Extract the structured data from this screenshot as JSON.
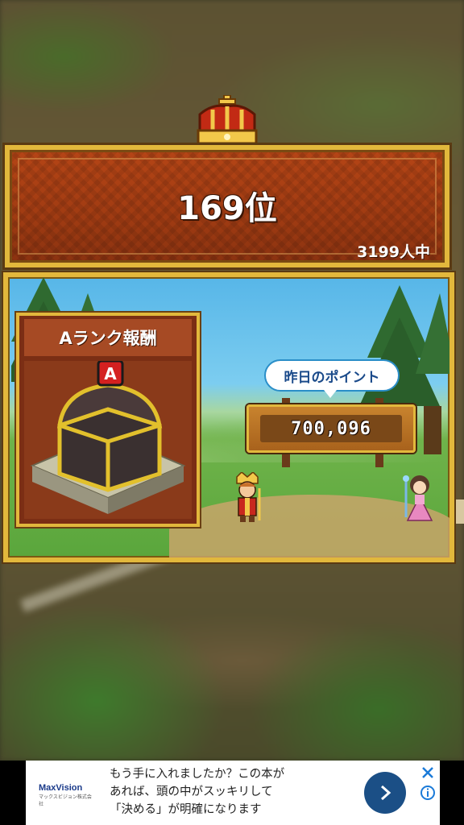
{
  "ranking": {
    "rank_text": "169位",
    "total_text": "3199人中"
  },
  "reward": {
    "title": "Aランク報酬",
    "chest_badge": "A",
    "chest_icon": "treasure-chest-icon"
  },
  "points": {
    "label": "昨日のポイント",
    "value": "700,096"
  },
  "ad": {
    "logo": "MaxVision",
    "logo_sub": "マックスビジョン株式会社",
    "lines": [
      "もう手に入れましたか？この本が",
      "あれば、頭の中がスッキリして",
      "「決める」が明確になります"
    ],
    "go_icon": "chevron-right-icon",
    "close_icon": "close-icon",
    "info_icon": "info-icon"
  },
  "colors": {
    "banner_red": "#a03b12",
    "gold_frame": "#e2b83c",
    "ad_button": "#1b4f86"
  }
}
